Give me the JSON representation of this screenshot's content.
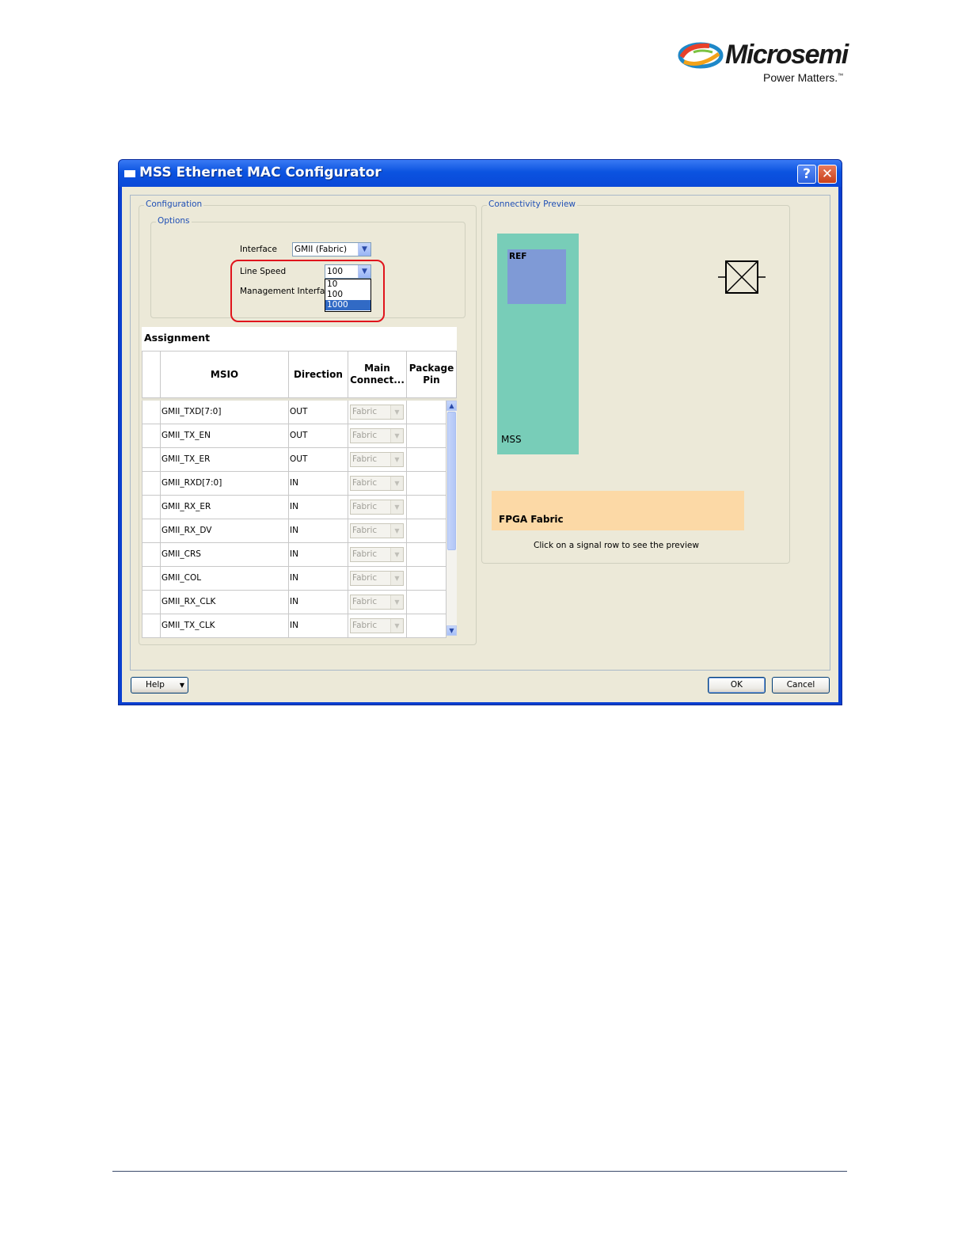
{
  "logo": {
    "brand": "Microsemi",
    "trademark": "®",
    "tagline": "Power Matters.",
    "tagline_mark": "™"
  },
  "window": {
    "title": "MSS Ethernet MAC Configurator",
    "help_glyph": "?",
    "close_glyph": "✕"
  },
  "configuration": {
    "group_label": "Configuration",
    "options_label": "Options",
    "interface_label": "Interface",
    "interface_value": "GMII (Fabric)",
    "line_speed_label": "Line Speed",
    "line_speed_value": "100",
    "line_speed_options": [
      "10",
      "100",
      "1000"
    ],
    "line_speed_highlighted": "1000",
    "management_label": "Management Interface"
  },
  "assignment": {
    "title": "Assignment",
    "headers": {
      "msio": "MSIO",
      "direction": "Direction",
      "main": "Main Connect...",
      "package": "Package Pin"
    },
    "rows": [
      {
        "msio": "GMII_TXD[7:0]",
        "direction": "OUT",
        "main": "Fabric"
      },
      {
        "msio": "GMII_TX_EN",
        "direction": "OUT",
        "main": "Fabric"
      },
      {
        "msio": "GMII_TX_ER",
        "direction": "OUT",
        "main": "Fabric"
      },
      {
        "msio": "GMII_RXD[7:0]",
        "direction": "IN",
        "main": "Fabric"
      },
      {
        "msio": "GMII_RX_ER",
        "direction": "IN",
        "main": "Fabric"
      },
      {
        "msio": "GMII_RX_DV",
        "direction": "IN",
        "main": "Fabric"
      },
      {
        "msio": "GMII_CRS",
        "direction": "IN",
        "main": "Fabric"
      },
      {
        "msio": "GMII_COL",
        "direction": "IN",
        "main": "Fabric"
      },
      {
        "msio": "GMII_RX_CLK",
        "direction": "IN",
        "main": "Fabric"
      },
      {
        "msio": "GMII_TX_CLK",
        "direction": "IN",
        "main": "Fabric"
      }
    ]
  },
  "preview": {
    "group_label": "Connectivity Preview",
    "ref_label": "REF",
    "mss_label": "MSS",
    "fpga_label": "FPGA Fabric",
    "hint": "Click on a signal row to see the preview"
  },
  "buttons": {
    "help": "Help",
    "ok": "OK",
    "cancel": "Cancel"
  },
  "colors": {
    "title_blue": "#0b53e0",
    "highlight_red": "#e0141c",
    "mss_green": "#78cdb8",
    "ref_blue": "#7f9ad6",
    "fpga_orange": "#fcd9a6"
  }
}
